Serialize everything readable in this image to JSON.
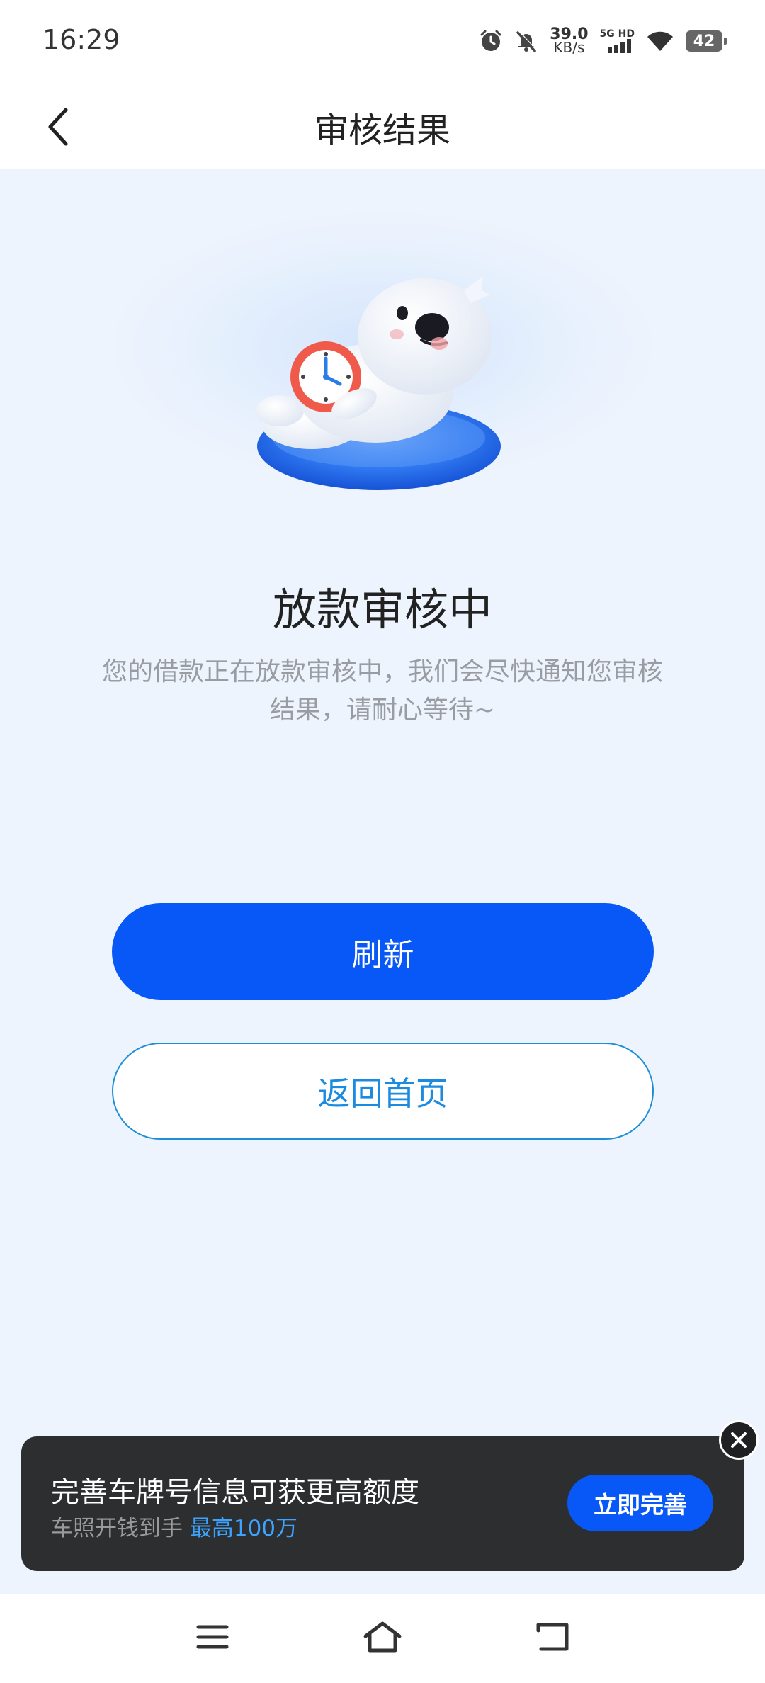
{
  "status_bar": {
    "time": "16:29",
    "net_speed_value": "39.0",
    "net_speed_unit": "KB/s",
    "network_type": "5G HD",
    "battery": "42",
    "icons": [
      "alarm-icon",
      "mute-icon",
      "signal-icon",
      "wifi-icon",
      "battery-icon"
    ]
  },
  "header": {
    "title": "审核结果",
    "back_icon": "chevron-left-icon"
  },
  "main": {
    "status_title": "放款审核中",
    "status_description": "您的借款正在放款审核中，我们会尽快通知您审核结果，请耐心等待~",
    "refresh_label": "刷新",
    "home_label": "返回首页"
  },
  "promo": {
    "title": "完善车牌号信息可获更高额度",
    "subtitle": "车照开钱到手",
    "highlight": "最高100万",
    "button_label": "立即完善"
  },
  "colors": {
    "primary": "#0858f7",
    "background": "#eef4fd",
    "secondary_text": "#9a9ca3",
    "outline_button": "#1a8be0",
    "promo_background": "#2d2e30",
    "promo_highlight": "#3ca3ff"
  },
  "system_nav": {
    "icons": [
      "menu-icon",
      "home-icon",
      "back-icon"
    ]
  }
}
